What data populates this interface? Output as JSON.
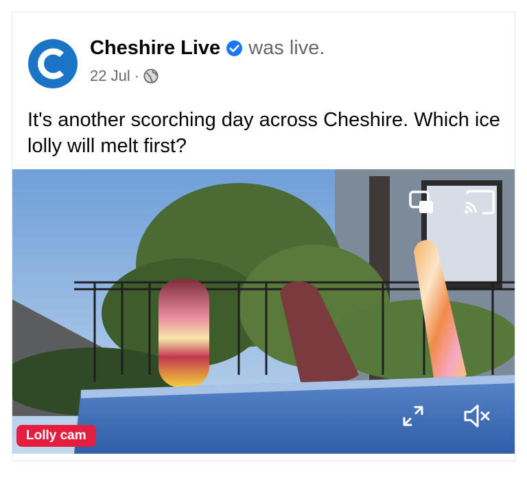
{
  "post": {
    "page_name": "Cheshire Live",
    "avatar_letter": "C",
    "status": "was live.",
    "date": "22 Jul",
    "separator": "·",
    "text": "It's another scorching day across Cheshire. Which ice lolly will melt first?"
  },
  "video": {
    "badge": "Lolly cam",
    "icons": [
      "picture-in-picture-icon",
      "cast-icon",
      "fullscreen-icon",
      "mute-icon"
    ]
  },
  "colors": {
    "brand_blue": "#1877f2",
    "badge_red": "#e41e3f",
    "meta_grey": "#65676b"
  }
}
